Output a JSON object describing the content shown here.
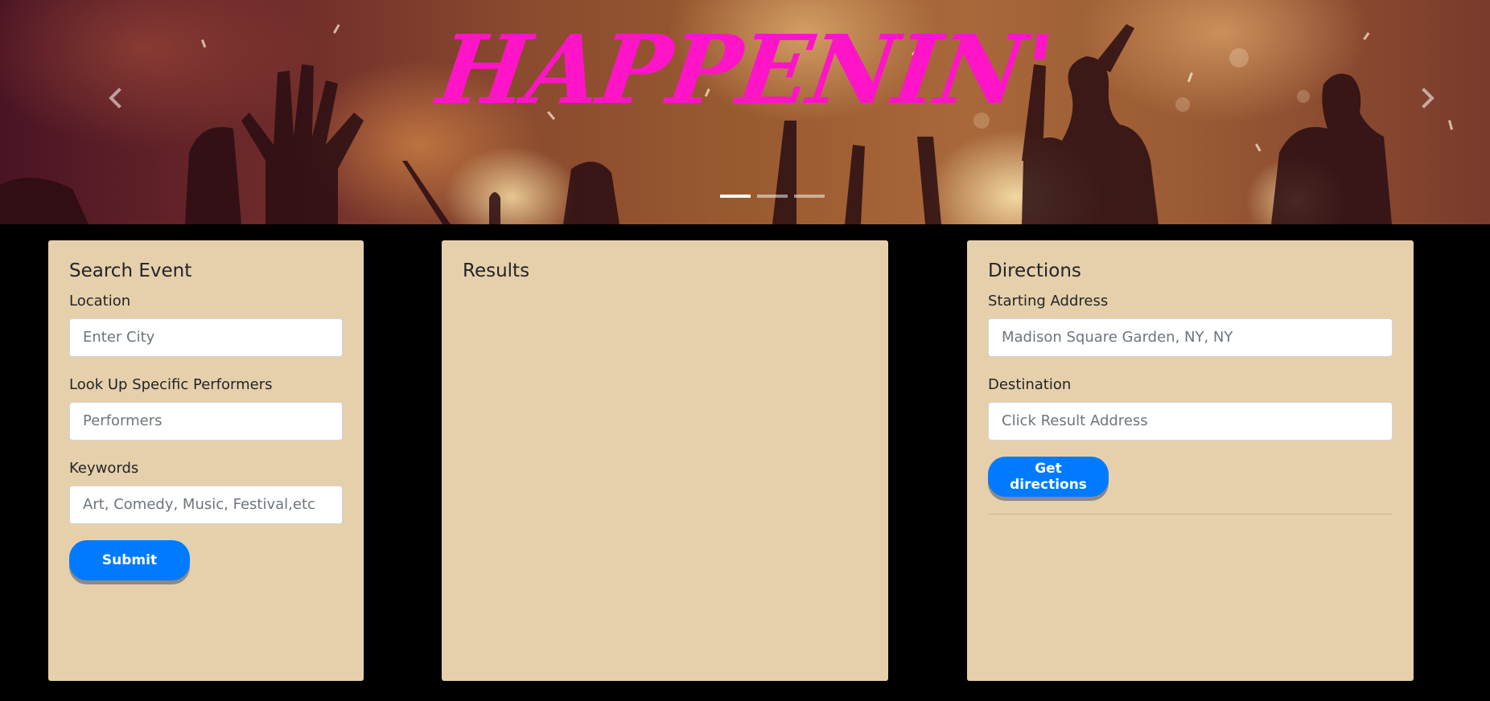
{
  "hero": {
    "title": "HAPPENIN'",
    "prev_icon": "chevron-left-icon",
    "next_icon": "chevron-right-icon",
    "indicators": [
      {
        "active": true
      },
      {
        "active": false
      },
      {
        "active": false
      }
    ],
    "title_color": "#ff14c8"
  },
  "search": {
    "heading": "Search Event",
    "location_label": "Location",
    "location_placeholder": "Enter City",
    "performers_label": "Look Up Specific Performers",
    "performers_placeholder": "Performers",
    "keywords_label": "Keywords",
    "keywords_placeholder": "Art, Comedy, Music, Festival,etc",
    "submit_label": "Submit"
  },
  "results": {
    "heading": "Results"
  },
  "directions": {
    "heading": "Directions",
    "start_label": "Starting Address",
    "start_placeholder": "Madison Square Garden, NY, NY",
    "destination_label": "Destination",
    "destination_placeholder": "Click Result Address",
    "button_label": "Get directions"
  },
  "colors": {
    "panel_bg": "#e6d0ab",
    "button_bg": "#007bff",
    "page_bg": "#000000"
  }
}
